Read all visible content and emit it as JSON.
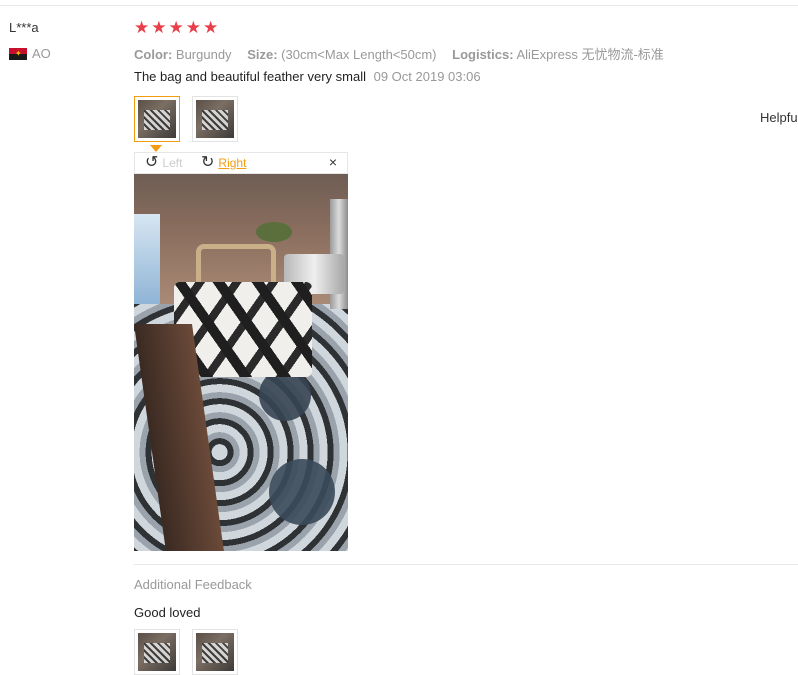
{
  "reviewer": {
    "name": "L***a",
    "country_code": "AO"
  },
  "rating": {
    "stars": 5,
    "max": 5
  },
  "attributes": {
    "color_label": "Color:",
    "color_value": "Burgundy",
    "size_label": "Size:",
    "size_value": "(30cm<Max Length<50cm)",
    "logistics_label": "Logistics:",
    "logistics_value": "AliExpress 无忧物流-标准"
  },
  "review": {
    "text": "The bag and beautiful feather very small",
    "date": "09 Oct 2019 03:06"
  },
  "helpful_label": "Helpfu",
  "viewer": {
    "rotate_left_label": "Left",
    "rotate_right_label": "Right",
    "close_symbol": "×"
  },
  "additional": {
    "title": "Additional Feedback",
    "text": "Good loved"
  },
  "colors": {
    "star": "#e8404a",
    "accent": "#f39c12",
    "muted_text": "#999999"
  },
  "icons": {
    "flag": "angola-flag-icon",
    "rotate_left": "rotate-left-icon",
    "rotate_right": "rotate-right-icon",
    "close": "close-icon",
    "star": "star-icon"
  }
}
